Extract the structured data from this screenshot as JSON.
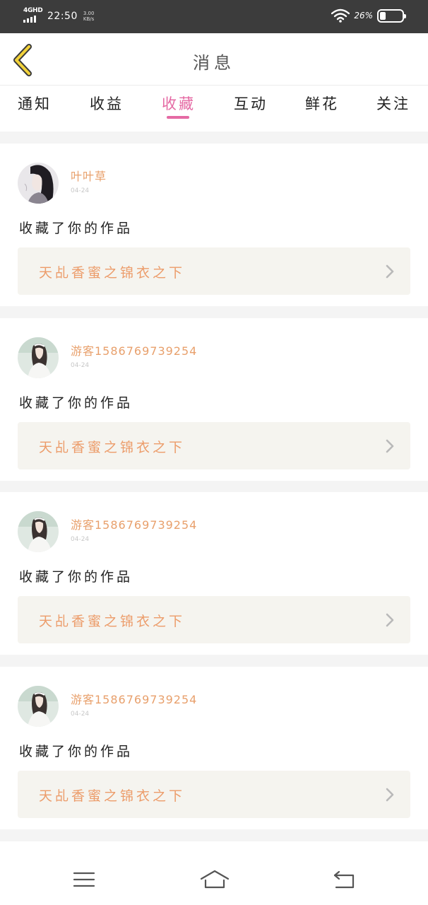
{
  "status_bar": {
    "network": "4GHD",
    "time": "22:50",
    "speed_value": "3.00",
    "speed_unit": "KB/s",
    "battery_text": "26%",
    "battery_level": 0.26
  },
  "header": {
    "title": "消息",
    "back_icon": "chevron-left-icon"
  },
  "tabs": [
    {
      "label": "通知",
      "active": false
    },
    {
      "label": "收益",
      "active": false
    },
    {
      "label": "收藏",
      "active": true
    },
    {
      "label": "互动",
      "active": false
    },
    {
      "label": "鲜花",
      "active": false
    },
    {
      "label": "关注",
      "active": false
    }
  ],
  "notifications": [
    {
      "username": "叶叶草",
      "date": "04-24",
      "action": "收藏了你的作品",
      "work_title": "天乩香蜜之锦衣之下"
    },
    {
      "username": "游客1586769739254",
      "date": "04-24",
      "action": "收藏了你的作品",
      "work_title": "天乩香蜜之锦衣之下"
    },
    {
      "username": "游客1586769739254",
      "date": "04-24",
      "action": "收藏了你的作品",
      "work_title": "天乩香蜜之锦衣之下"
    },
    {
      "username": "游客1586769739254",
      "date": "04-24",
      "action": "收藏了你的作品",
      "work_title": "天乩香蜜之锦衣之下"
    }
  ],
  "bottom_nav": {
    "menu_icon": "menu-icon",
    "home_icon": "home-icon",
    "back_icon": "return-icon"
  },
  "colors": {
    "accent_pink": "#e56aa4",
    "username_orange": "#e8a06c",
    "work_title_orange": "#ec9c6a",
    "back_arrow_yellow": "#f2d23a"
  }
}
